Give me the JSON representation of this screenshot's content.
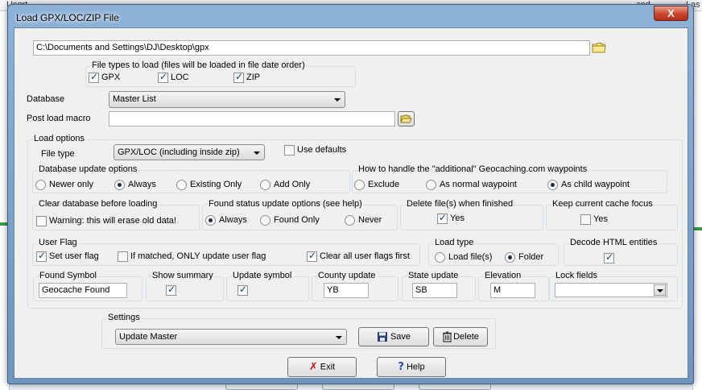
{
  "background": {
    "top_left_text": "Usort",
    "top_right_text": "Las",
    "top_mid_text": "cod"
  },
  "window": {
    "title": "Load GPX/LOC/ZIP File",
    "close_label": "X"
  },
  "path": {
    "value": "C:\\Documents and Settings\\DJ\\Desktop\\gpx"
  },
  "file_types": {
    "legend": "File types to load (files will be loaded in file date order)",
    "gpx": "GPX",
    "loc": "LOC",
    "zip": "ZIP"
  },
  "database": {
    "label": "Database",
    "value": "Master List"
  },
  "post_load_macro": {
    "label": "Post load macro",
    "value": ""
  },
  "load_options": {
    "legend": "Load options",
    "file_type_label": "File type",
    "file_type_value": "GPX/LOC (including inside zip)",
    "use_defaults": "Use defaults"
  },
  "db_update": {
    "legend": "Database update options",
    "newer_only": "Newer only",
    "always": "Always",
    "existing_only": "Existing Only",
    "add_only": "Add Only"
  },
  "additional_wpts": {
    "legend": "How to handle the \"additional\" Geocaching.com waypoints",
    "exclude": "Exclude",
    "normal": "As normal waypoint",
    "child": "As child waypoint"
  },
  "clear_db": {
    "legend": "Clear database before loading",
    "warning": "Warning: this will erase old data!"
  },
  "found_status": {
    "legend": "Found status update options (see help)",
    "always": "Always",
    "found_only": "Found Only",
    "never": "Never"
  },
  "delete_files": {
    "legend": "Delete file(s) when finished",
    "yes": "Yes"
  },
  "keep_focus": {
    "legend": "Keep current cache focus",
    "yes": "Yes"
  },
  "user_flag": {
    "legend": "User Flag",
    "set": "Set user flag",
    "if_matched": "If matched, ONLY update user flag",
    "clear_all": "Clear all user flags first"
  },
  "load_type": {
    "legend": "Load type",
    "files": "Load file(s)",
    "folder": "Folder"
  },
  "decode_html": {
    "legend": "Decode HTML entities"
  },
  "found_symbol": {
    "legend": "Found Symbol",
    "value": "Geocache Found"
  },
  "show_summary": {
    "legend": "Show summary"
  },
  "update_symbol": {
    "legend": "Update symbol"
  },
  "county_update": {
    "legend": "County update",
    "value": "YB"
  },
  "state_update": {
    "legend": "State update",
    "value": "SB"
  },
  "elevation": {
    "legend": "Elevation",
    "value": "M"
  },
  "lock_fields": {
    "legend": "Lock fields",
    "value": ""
  },
  "settings": {
    "legend": "Settings",
    "value": "Update Master",
    "save": "Save",
    "delete": "Delete"
  },
  "footer": {
    "exit": "Exit",
    "help": "Help"
  },
  "colors": {
    "frame": "#8db2d8",
    "close": "#c9452e",
    "client": "#f0f0f0"
  }
}
